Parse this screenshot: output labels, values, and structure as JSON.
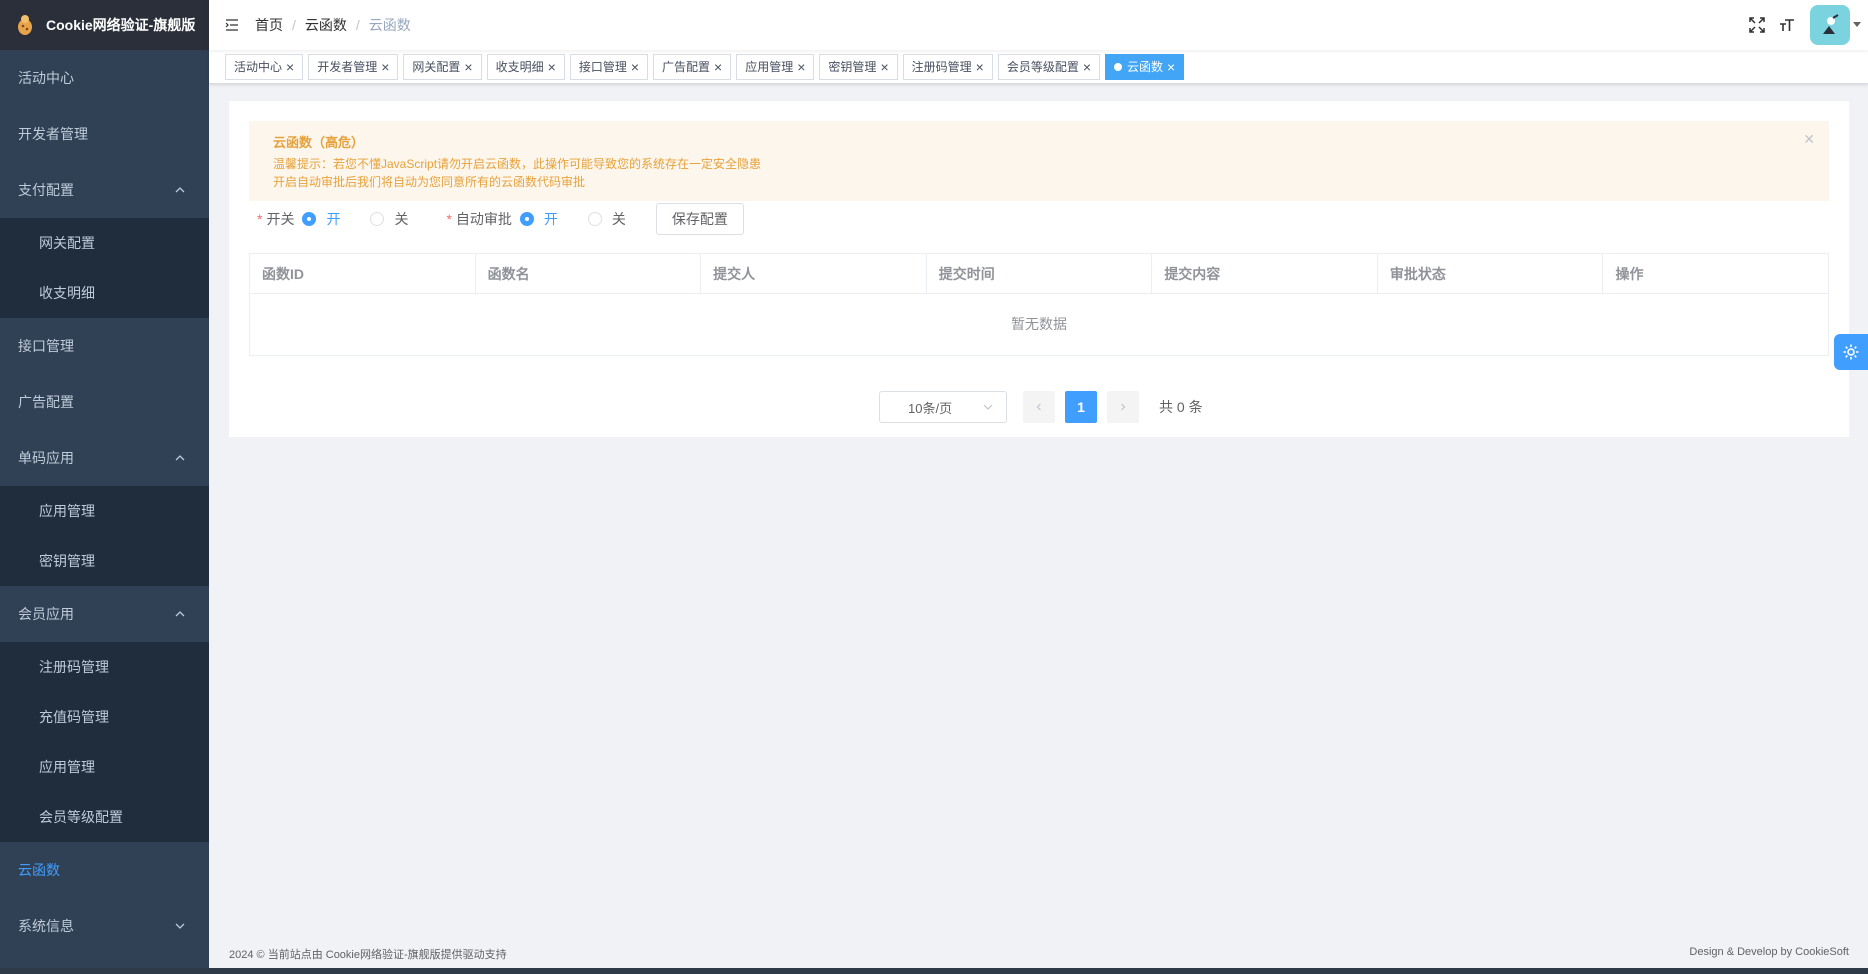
{
  "app": {
    "title": "Cookie网络验证-旗舰版"
  },
  "sidebar": {
    "items": [
      {
        "label": "活动中心"
      },
      {
        "label": "开发者管理"
      },
      {
        "label": "支付配置",
        "children": [
          "网关配置",
          "收支明细"
        ]
      },
      {
        "label": "接口管理"
      },
      {
        "label": "广告配置"
      },
      {
        "label": "单码应用",
        "children": [
          "应用管理",
          "密钥管理"
        ]
      },
      {
        "label": "会员应用",
        "children": [
          "注册码管理",
          "充值码管理",
          "应用管理",
          "会员等级配置"
        ]
      },
      {
        "label": "云函数"
      },
      {
        "label": "系统信息"
      }
    ]
  },
  "breadcrumb": [
    "首页",
    "云函数",
    "云函数"
  ],
  "tags": [
    "活动中心",
    "开发者管理",
    "网关配置",
    "收支明细",
    "接口管理",
    "广告配置",
    "应用管理",
    "密钥管理",
    "注册码管理",
    "会员等级配置",
    "云函数"
  ],
  "alert": {
    "title": "云函数（高危）",
    "line1": "温馨提示：若您不懂JavaScript请勿开启云函数，此操作可能导致您的系统存在一定安全隐患",
    "line2": "开启自动审批后我们将自动为您同意所有的云函数代码审批"
  },
  "form": {
    "switch_label": "开关",
    "auto_label": "自动审批",
    "on": "开",
    "off": "关",
    "save": "保存配置"
  },
  "table": {
    "columns": [
      "函数ID",
      "函数名",
      "提交人",
      "提交时间",
      "提交内容",
      "审批状态",
      "操作"
    ],
    "empty": "暂无数据"
  },
  "pagination": {
    "page_size": "10条/页",
    "current": "1",
    "total": "共 0 条"
  },
  "footer": {
    "left": "2024 © 当前站点由 Cookie网络验证-旗舰版提供驱动支持",
    "right": "Design & Develop by CookieSoft"
  },
  "colors": {
    "primary": "#409eff",
    "sidebar": "#304156",
    "warning": "#e6a23c"
  }
}
